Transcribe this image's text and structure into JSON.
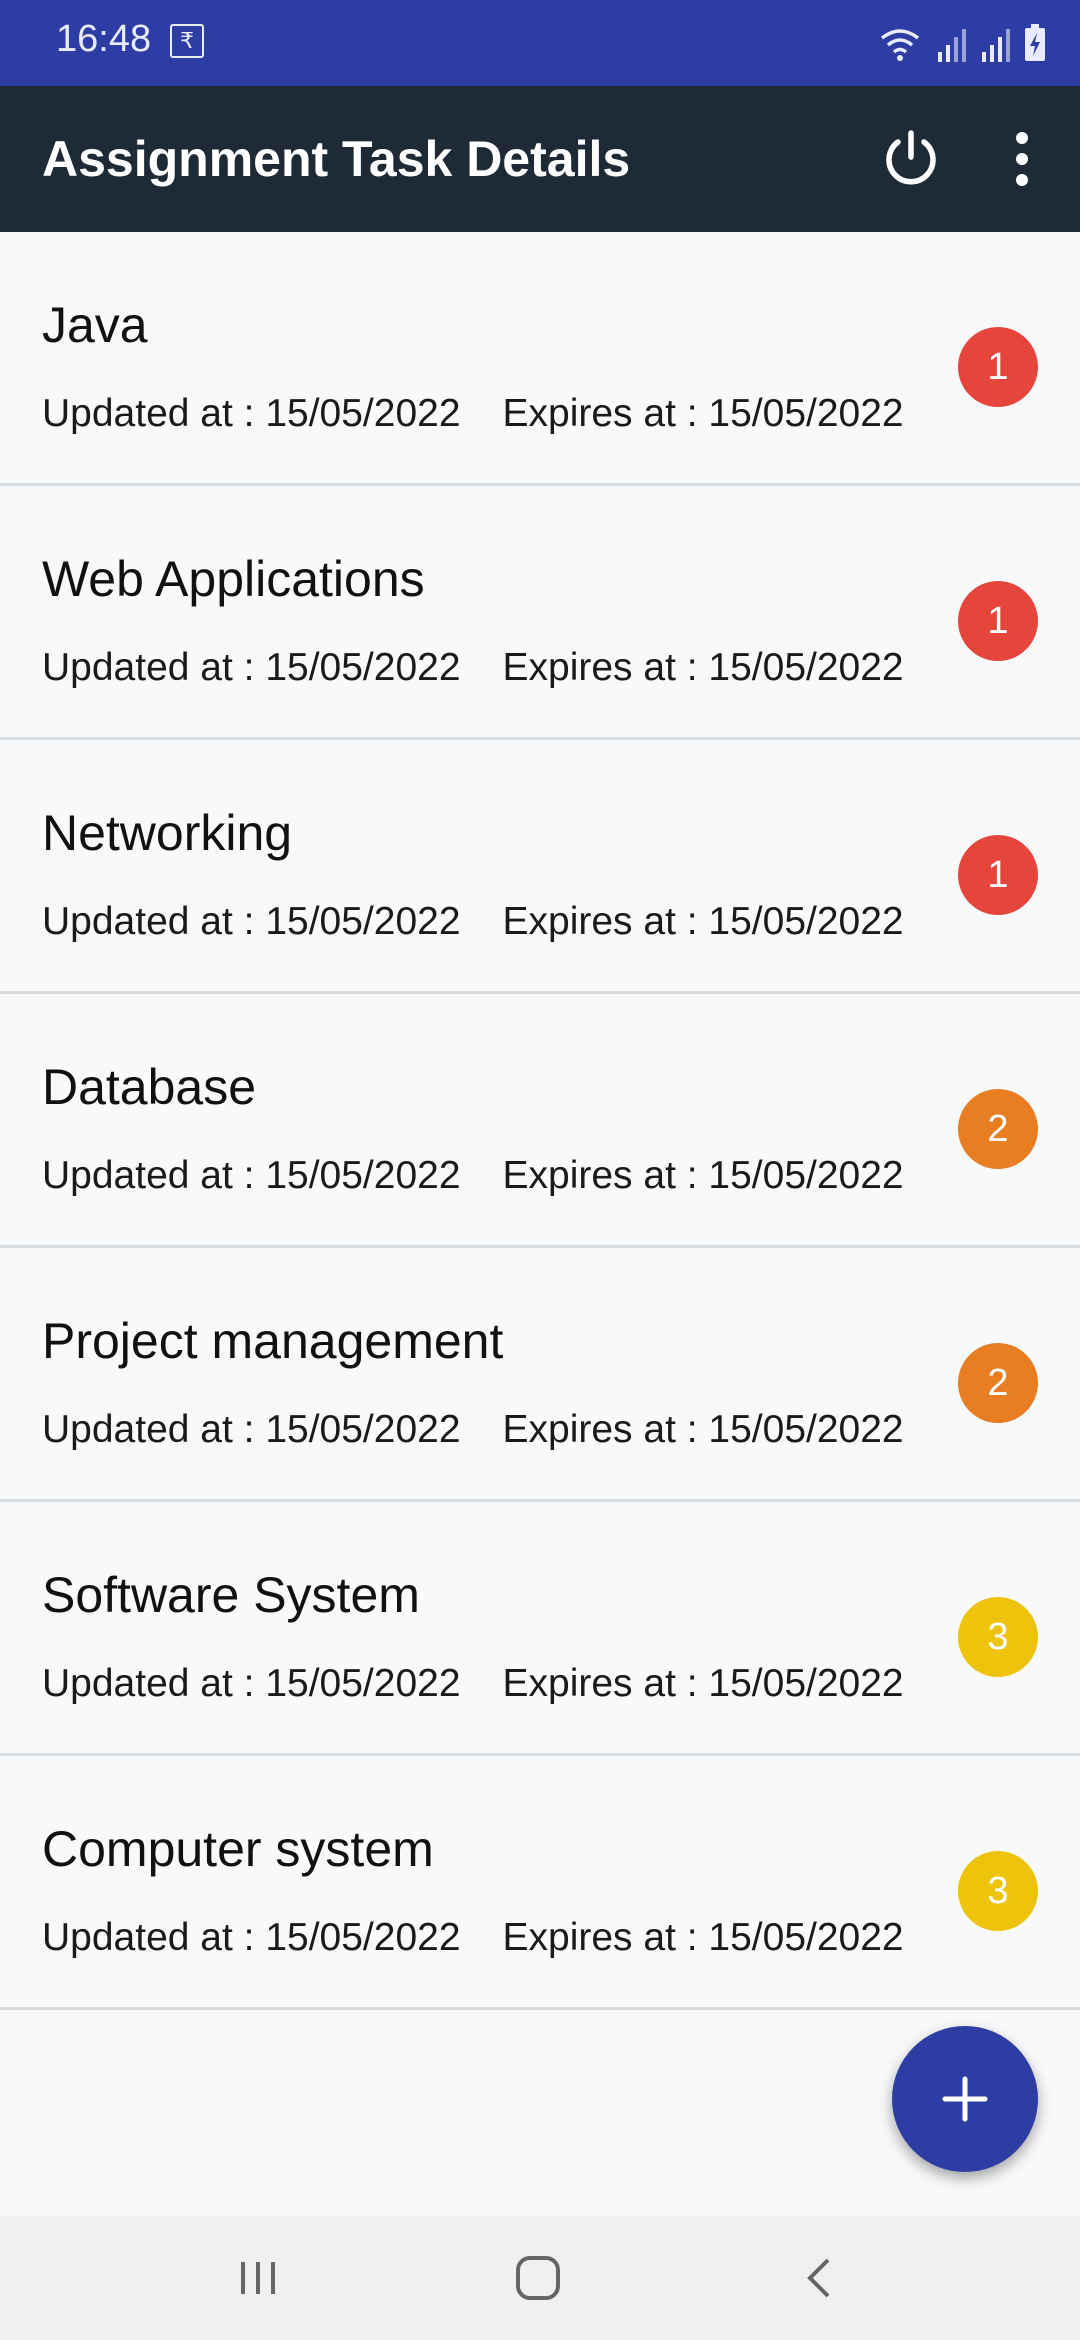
{
  "status_bar": {
    "time": "16:48",
    "notification_icon": "rupee-icon",
    "notification_glyph": "₹",
    "icons": [
      "wifi-icon",
      "signal-icon",
      "signal-icon",
      "battery-charging-icon"
    ]
  },
  "app_bar": {
    "title": "Assignment Task Details",
    "actions": [
      "power-icon",
      "more-vert-icon"
    ]
  },
  "tasks": [
    {
      "title": "Java",
      "updated": "Updated at : 15/05/2022",
      "expires": "Expires at : 15/05/2022",
      "priority": "1",
      "badge_color": "#e5453a"
    },
    {
      "title": "Web Applications",
      "updated": "Updated at : 15/05/2022",
      "expires": "Expires at : 15/05/2022",
      "priority": "1",
      "badge_color": "#e5453a"
    },
    {
      "title": "Networking",
      "updated": "Updated at : 15/05/2022",
      "expires": "Expires at : 15/05/2022",
      "priority": "1",
      "badge_color": "#e5453a"
    },
    {
      "title": "Database",
      "updated": "Updated at : 15/05/2022",
      "expires": "Expires at : 15/05/2022",
      "priority": "2",
      "badge_color": "#e87d22"
    },
    {
      "title": "Project management",
      "updated": "Updated at : 15/05/2022",
      "expires": "Expires at : 15/05/2022",
      "priority": "2",
      "badge_color": "#e87d22"
    },
    {
      "title": "Software System",
      "updated": "Updated at : 15/05/2022",
      "expires": "Expires at : 15/05/2022",
      "priority": "3",
      "badge_color": "#eec30c"
    },
    {
      "title": "Computer system",
      "updated": "Updated at : 15/05/2022",
      "expires": "Expires at : 15/05/2022",
      "priority": "3",
      "badge_color": "#eec30c"
    }
  ],
  "fab": {
    "icon": "add-icon"
  },
  "nav_bar": {
    "buttons": [
      "recents-icon",
      "home-icon",
      "back-icon"
    ]
  },
  "colors": {
    "status_bar": "#2e3da4",
    "app_bar": "#1e2b36",
    "background": "#f8f9fa",
    "fab": "#2e3da4"
  }
}
